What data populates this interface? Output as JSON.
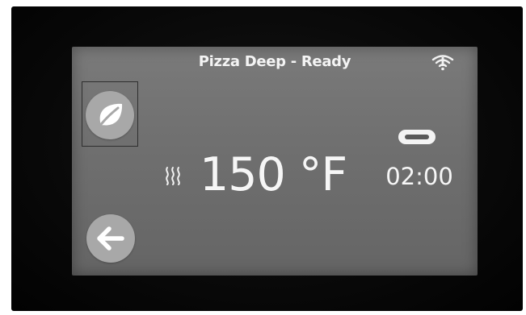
{
  "header": {
    "title": "Pizza Deep - Ready"
  },
  "status": {
    "wifi_icon": "wifi-icon"
  },
  "controls": {
    "eco_icon": "leaf-icon",
    "back_icon": "arrow-left-icon"
  },
  "cooking": {
    "heat_icon": "heat-waves-icon",
    "temperature": "150 °F",
    "timer_icon": "timer-toggle-icon",
    "time": "02:00"
  },
  "colors": {
    "screen_background": "#717171",
    "text": "#f4f4f4",
    "button_fill": "#a8a8a8",
    "bezel": "#0a0a0a"
  }
}
